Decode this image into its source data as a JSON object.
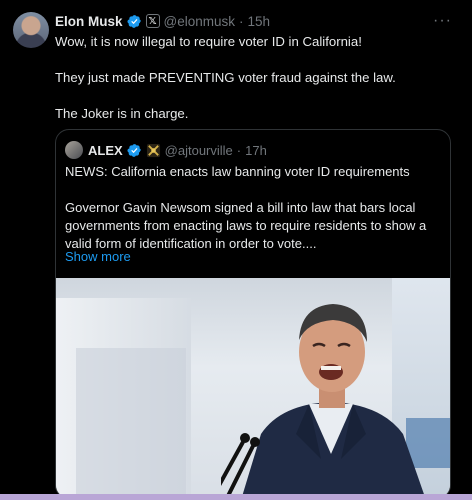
{
  "tweet": {
    "author_name": "Elon Musk",
    "author_handle": "@elonmusk",
    "time_sep": "·",
    "time": "15h",
    "affiliate_badge": "𝕏",
    "more_label": "···",
    "lines": [
      "Wow, it is now illegal to require voter ID in California!",
      "They just made PREVENTING voter fraud against the law.",
      "The Joker is in charge."
    ]
  },
  "quote": {
    "author_name": "ALEX",
    "author_handle": "@ajtourville",
    "time_sep": "·",
    "time": "17h",
    "headline": "NEWS: California enacts law banning voter ID requirements",
    "paragraph": "Governor Gavin Newsom signed a bill into law that bars local governments from enacting laws to require residents to show a valid form of identification in order to vote....",
    "show_more": "Show more"
  },
  "colors": {
    "background": "#000000",
    "text": "#e7e9ea",
    "muted": "#71767b",
    "link": "#1d9bf0",
    "verified": "#1d9bf0",
    "border": "#2f3336"
  },
  "icons": {
    "verified": "verified-badge-icon",
    "affiliate": "x-affiliate-icon",
    "crest": "gold-crest-icon",
    "more": "more-options-icon"
  }
}
